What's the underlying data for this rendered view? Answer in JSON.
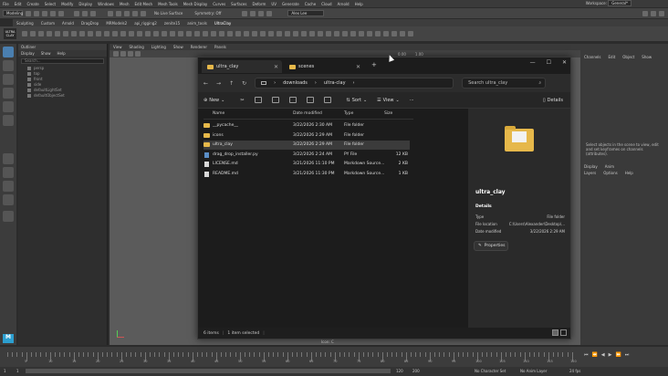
{
  "maya": {
    "menubar": [
      "File",
      "Edit",
      "Create",
      "Select",
      "Modify",
      "Display",
      "Windows",
      "Mesh",
      "Edit Mesh",
      "Mesh Tools",
      "Mesh Display",
      "Curves",
      "Surfaces",
      "Deform",
      "UV",
      "Generate",
      "Cache",
      "Cloud",
      "Arnold",
      "Help"
    ],
    "workspace_label": "Workspace:",
    "workspace_value": "General*",
    "mode": "Modeling",
    "live_surface": "No Live Surface",
    "symmetry": "Symmetry: Off",
    "user": "Alex Lee",
    "shelf_tabs": [
      "Sculpting",
      "Custom",
      "Arnold",
      "DragDrop",
      "MRModels2",
      "api_rigging2",
      "zenite15",
      "anim_tools",
      "UltraClay"
    ],
    "shelf_active": "UltraClay",
    "shelf_logo": "ULTRA CLAY",
    "viewport_menu": [
      "View",
      "Shading",
      "Lighting",
      "Show",
      "Renderer",
      "Panels"
    ],
    "viewport_values": [
      "0.00",
      "1.00"
    ],
    "outliner": {
      "title": "Outliner",
      "menu": [
        "Display",
        "Show",
        "Help"
      ],
      "search_placeholder": "Search...",
      "items": [
        "persp",
        "top",
        "front",
        "side",
        "defaultLightSet",
        "defaultObjectSet"
      ]
    },
    "channelbox": {
      "menu": [
        "Channels",
        "Edit",
        "Object",
        "Show"
      ],
      "hint": "Select objects in the scene to view, edit and set keyframes on channels (attributes).",
      "layer_tabs": [
        "Display",
        "Anim"
      ],
      "layer_menu": [
        "Layers",
        "Options",
        "Help"
      ]
    },
    "timeline_numbers": [
      "5",
      "10",
      "15",
      "20",
      "25",
      "30",
      "35",
      "40",
      "45",
      "50",
      "55",
      "60",
      "65",
      "70",
      "75",
      "80",
      "85",
      "90",
      "95",
      "100",
      "105",
      "110",
      "115",
      "120"
    ],
    "current_frame": "1",
    "range_start": "1",
    "range_end": "120",
    "range_end2": "200",
    "range_current": "1",
    "no_character_set": "No Character Set",
    "no_anim_layer": "No Anim Layer",
    "fps": "24 fps",
    "icon_label": "Icon: C"
  },
  "explorer": {
    "tabs": [
      {
        "label": "ultra_clay",
        "active": true
      },
      {
        "label": "scenes",
        "active": false
      }
    ],
    "new_tab": "+",
    "window_controls": [
      "—",
      "☐",
      "✕"
    ],
    "breadcrumb": [
      "downloads",
      "ultra-clay"
    ],
    "search_placeholder": "Search ultra_clay",
    "toolbar": {
      "new_label": "New",
      "sort_label": "Sort",
      "view_label": "View",
      "more_label": "···",
      "details_label": "Details"
    },
    "columns": [
      "Name",
      "Date modified",
      "Type",
      "Size"
    ],
    "files": [
      {
        "name": "__pycache__",
        "date": "3/22/2026 2:30 AM",
        "type": "File folder",
        "size": "",
        "kind": "folder"
      },
      {
        "name": "icons",
        "date": "3/22/2026 2:29 AM",
        "type": "File folder",
        "size": "",
        "kind": "folder"
      },
      {
        "name": "ultra_clay",
        "date": "3/22/2026 2:29 AM",
        "type": "File folder",
        "size": "",
        "kind": "folder",
        "selected": true
      },
      {
        "name": "drag_drop_installer.py",
        "date": "3/22/2026 2:24 AM",
        "type": "PY File",
        "size": "12 KB",
        "kind": "py"
      },
      {
        "name": "LICENSE.md",
        "date": "3/21/2026 11:10 PM",
        "type": "Markdown Source...",
        "size": "2 KB",
        "kind": "file"
      },
      {
        "name": "README.md",
        "date": "3/21/2026 11:30 PM",
        "type": "Markdown Source...",
        "size": "1 KB",
        "kind": "file"
      }
    ],
    "details": {
      "name": "ultra_clay",
      "heading": "Details",
      "type_label": "Type",
      "type_value": "File folder",
      "location_label": "File location",
      "location_value": "C:\\Users\\Alexander\\Desktop\\...",
      "modified_label": "Date modified",
      "modified_value": "3/22/2026 2:29 AM",
      "properties_label": "Properties"
    },
    "status": {
      "items": "6 items",
      "selected": "1 item selected"
    }
  }
}
